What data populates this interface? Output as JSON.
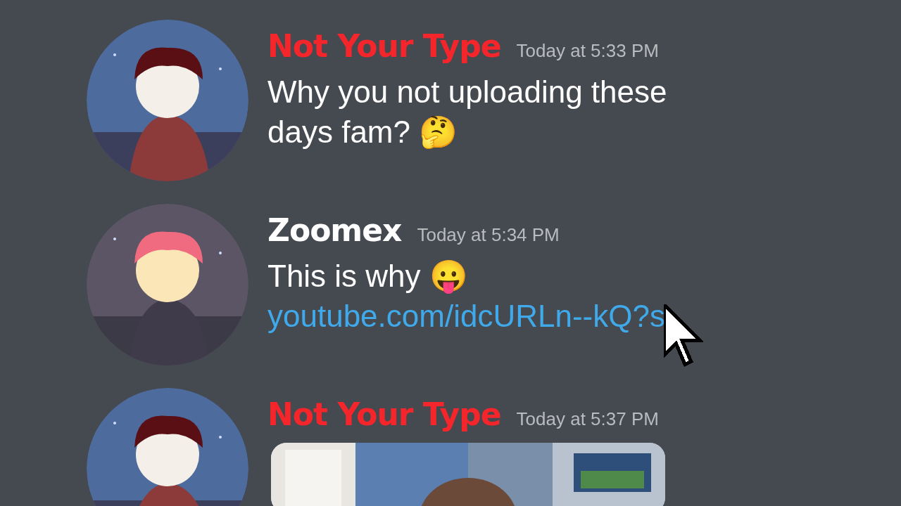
{
  "messages": [
    {
      "author": {
        "name": "Not Your Type",
        "color": "#f5262b"
      },
      "avatar": {
        "kind": "picture"
      },
      "timestamp": "Today at 5:33 PM",
      "content": [
        {
          "kind": "text",
          "text": "Why you not uploading these days fam? 🤔"
        }
      ]
    },
    {
      "author": {
        "name": "Zoomex",
        "color": "#ffffff"
      },
      "avatar": {
        "kind": "picture"
      },
      "timestamp": "Today at 5:34 PM",
      "content": [
        {
          "kind": "text",
          "text": "This is why 😛"
        },
        {
          "kind": "link",
          "text": "youtube.com/idcURLn--kQ?s"
        }
      ]
    },
    {
      "author": {
        "name": "Not Your Type",
        "color": "#f5262b"
      },
      "avatar": {
        "kind": "picture"
      },
      "timestamp": "Today at 5:37 PM",
      "content": [
        {
          "kind": "picture"
        }
      ]
    }
  ]
}
